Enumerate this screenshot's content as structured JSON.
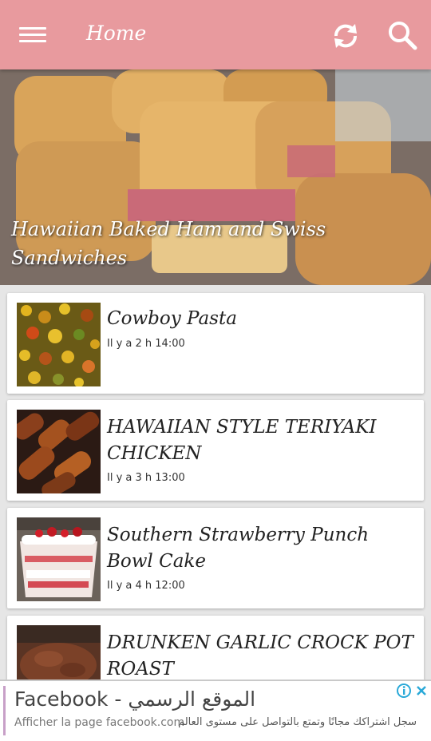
{
  "appbar": {
    "title": "Home",
    "color": "#e89a9e",
    "icons": {
      "menu": "menu-icon",
      "refresh": "refresh-icon",
      "search": "search-icon"
    }
  },
  "featured": {
    "title": "Hawaiian Baked Ham and Swiss Sandwiches"
  },
  "articles": [
    {
      "title": "Cowboy Pasta",
      "time": "Il y a 2 h 14:00"
    },
    {
      "title": "HAWAIIAN STYLE TERIYAKI CHICKEN",
      "time": "Il y a 3 h 13:00"
    },
    {
      "title": "Southern Strawberry Punch Bowl Cake",
      "time": "Il y a 4 h 12:00"
    },
    {
      "title": "DRUNKEN GARLIC CROCK POT ROAST",
      "time": ""
    }
  ],
  "ad": {
    "title": "Facebook - الموقع الرسمي",
    "subtitle_left": "Afficher la page facebook.com",
    "subtitle_right": "سجل اشتراكك مجانًا وتمتع بالتواصل على مستوى العالم",
    "accent": "#c8a0c8",
    "icons": {
      "info": "info-icon",
      "close": "close-icon"
    }
  }
}
